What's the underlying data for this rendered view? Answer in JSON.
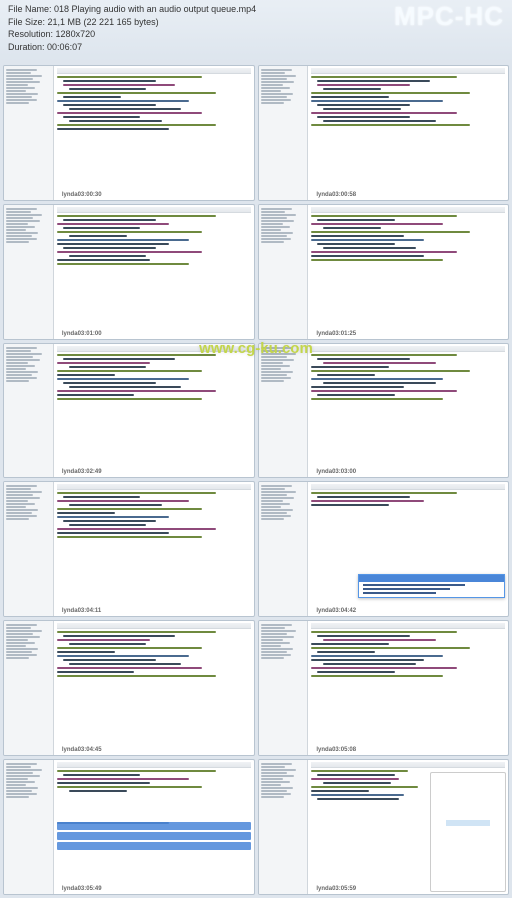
{
  "header": {
    "filename_label": "File Name:",
    "filename": "018 Playing audio with an audio output queue.mp4",
    "filesize_label": "File Size:",
    "filesize": "21,1 MB (22 221 165 bytes)",
    "resolution_label": "Resolution:",
    "resolution": "1280x720",
    "duration_label": "Duration:",
    "duration": "00:06:07",
    "app_logo": "MPC-HC"
  },
  "watermarks": {
    "site_url": "www.cg-ku.com",
    "brand": "lynda"
  },
  "timestamps": [
    "03:00:30",
    "03:00:58",
    "03:01:00",
    "03:01:25",
    "03:02:49",
    "03:03:00",
    "03:04:11",
    "03:04:42",
    "03:04:45",
    "03:05:08",
    "03:05:49",
    "03:05:59"
  ]
}
